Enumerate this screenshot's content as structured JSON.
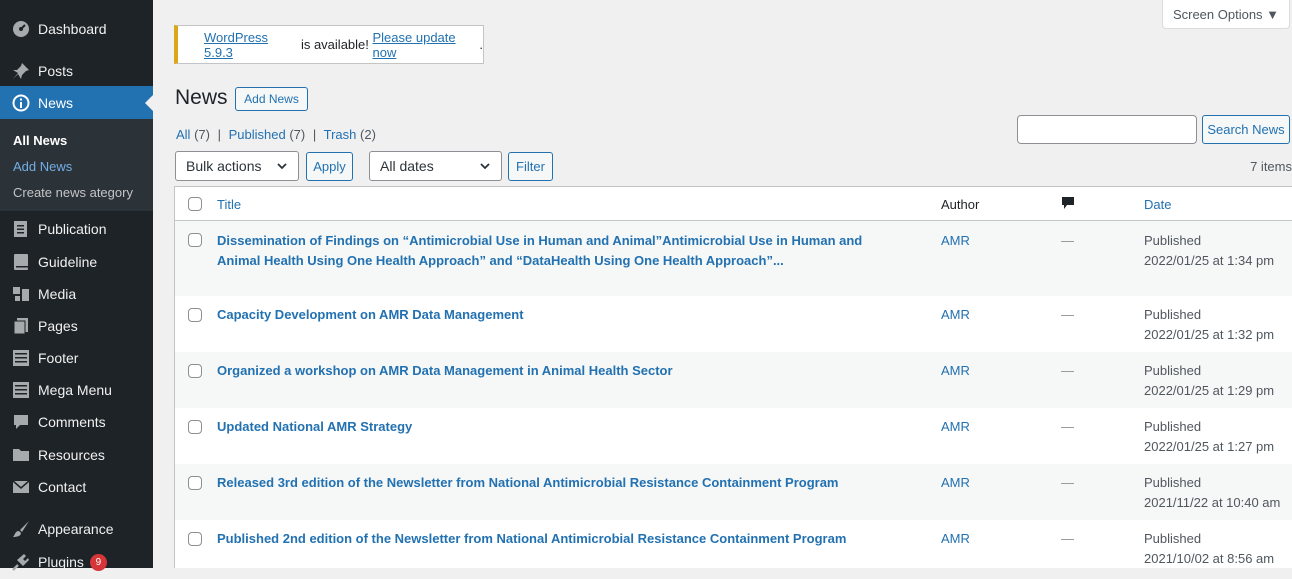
{
  "sidebar": {
    "items": [
      {
        "label": "Dashboard",
        "icon": "dashboard-icon"
      },
      {
        "label": "Posts",
        "icon": "pin-icon"
      },
      {
        "label": "News",
        "icon": "info-icon"
      },
      {
        "label": "Publication",
        "icon": "document-icon"
      },
      {
        "label": "Guideline",
        "icon": "book-icon"
      },
      {
        "label": "Media",
        "icon": "media-icon"
      },
      {
        "label": "Pages",
        "icon": "pages-icon"
      },
      {
        "label": "Footer",
        "icon": "table-icon"
      },
      {
        "label": "Mega Menu",
        "icon": "table-icon"
      },
      {
        "label": "Comments",
        "icon": "comment-icon"
      },
      {
        "label": "Resources",
        "icon": "folder-icon"
      },
      {
        "label": "Contact",
        "icon": "mail-icon"
      },
      {
        "label": "Appearance",
        "icon": "brush-icon"
      },
      {
        "label": "Plugins",
        "icon": "plugin-icon",
        "badge": "9"
      }
    ],
    "submenu": [
      "All News",
      "Add News",
      "Create news ategory"
    ]
  },
  "screen_options": "Screen Options ▼",
  "notice": {
    "version_link": "WordPress 5.9.3",
    "middle": " is available! ",
    "update_link": "Please update now",
    "end": "."
  },
  "page": {
    "title": "News",
    "add_button": "Add News"
  },
  "filters": {
    "all": "All",
    "all_count": "(7)",
    "published": "Published",
    "published_count": "(7)",
    "trash": "Trash",
    "trash_count": "(2)",
    "sep": "|",
    "bulk_actions": "Bulk actions",
    "apply": "Apply",
    "dates": "All dates",
    "filter": "Filter",
    "search_button": "Search News",
    "items_count": "7 items"
  },
  "table": {
    "columns": {
      "title": "Title",
      "author": "Author",
      "date": "Date"
    },
    "rows": [
      {
        "title": "Dissemination of Findings on “Antimicrobial Use in Human and Animal”Antimicrobial Use in Human and Animal Health Using One Health Approach” and “DataHealth Using One Health Approach”...",
        "author": "AMR",
        "comments": "—",
        "status": "Published",
        "date": "2022/01/25 at 1:34 pm"
      },
      {
        "title": "Capacity Development on AMR Data Management",
        "author": "AMR",
        "comments": "—",
        "status": "Published",
        "date": "2022/01/25 at 1:32 pm"
      },
      {
        "title": "Organized a workshop on AMR Data Management in Animal Health Sector",
        "author": "AMR",
        "comments": "—",
        "status": "Published",
        "date": "2022/01/25 at 1:29 pm"
      },
      {
        "title": "Updated National AMR Strategy",
        "author": "AMR",
        "comments": "—",
        "status": "Published",
        "date": "2022/01/25 at 1:27 pm"
      },
      {
        "title": "Released 3rd edition of the Newsletter from National Antimicrobial Resistance Containment Program",
        "author": "AMR",
        "comments": "—",
        "status": "Published",
        "date": "2021/11/22 at 10:40 am"
      },
      {
        "title": "Published 2nd edition of the Newsletter from National Antimicrobial Resistance Containment Program",
        "author": "AMR",
        "comments": "—",
        "status": "Published",
        "date": "2021/10/02 at 8:56 am"
      }
    ]
  }
}
